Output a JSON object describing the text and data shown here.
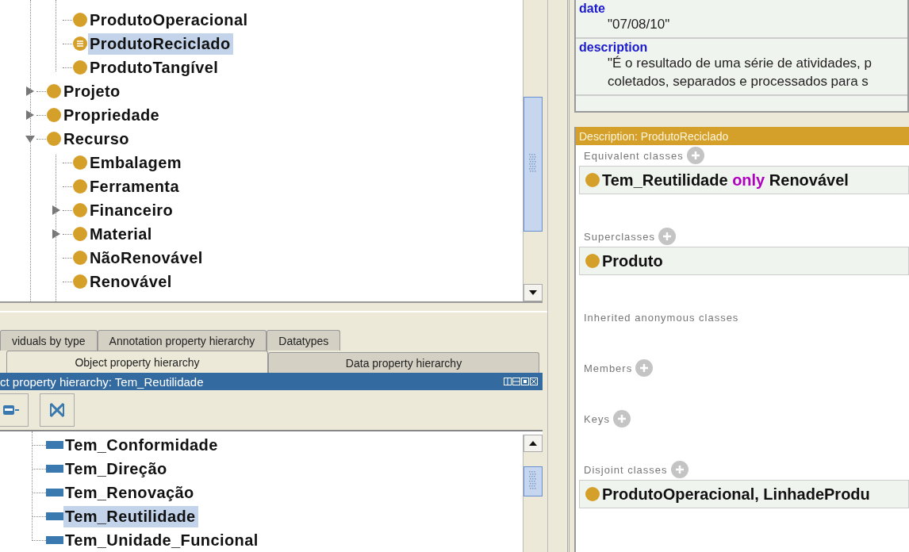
{
  "class_tree": {
    "partial_children": [
      {
        "label": "ProdutoOperacional",
        "kind": "primitive",
        "selected": false
      },
      {
        "label": "ProdutoReciclado",
        "kind": "defined",
        "selected": true
      },
      {
        "label": "ProdutoTangível",
        "kind": "primitive",
        "selected": false
      }
    ],
    "items": [
      {
        "label": "Projeto",
        "kind": "primitive",
        "selected": false,
        "expanded": false
      },
      {
        "label": "Propriedade",
        "kind": "primitive",
        "selected": false,
        "expanded": false
      },
      {
        "label": "Recurso",
        "kind": "primitive",
        "selected": false,
        "expanded": true,
        "children": [
          {
            "label": "Embalagem",
            "kind": "primitive",
            "selected": false
          },
          {
            "label": "Ferramenta",
            "kind": "primitive",
            "selected": false
          },
          {
            "label": "Financeiro",
            "kind": "primitive",
            "selected": false,
            "expanded": false
          },
          {
            "label": "Material",
            "kind": "primitive",
            "selected": false,
            "expanded": false
          },
          {
            "label": "NãoRenovável",
            "kind": "primitive",
            "selected": false
          },
          {
            "label": "Renovável",
            "kind": "primitive",
            "selected": false
          }
        ]
      }
    ]
  },
  "tab_rows": [
    [
      {
        "label": "viduals by type",
        "selected": false
      },
      {
        "label": "Annotation property hierarchy",
        "selected": false
      },
      {
        "label": "Datatypes",
        "selected": false
      }
    ],
    [
      {
        "label": "Object property hierarchy",
        "selected": true
      },
      {
        "label": "Data property hierarchy",
        "selected": false
      }
    ]
  ],
  "view": {
    "title": "ct property hierarchy: Tem_Reutilidade"
  },
  "properties": [
    {
      "label": "Tem_Conformidade",
      "selected": false
    },
    {
      "label": "Tem_Direção",
      "selected": false
    },
    {
      "label": "Tem_Renovação",
      "selected": false
    },
    {
      "label": "Tem_Reutilidade",
      "selected": true
    },
    {
      "label": "Tem_Unidade_Funcional",
      "selected": false
    }
  ],
  "annotations": [
    {
      "property": "date",
      "lines": [
        "\"07/08/10\""
      ]
    },
    {
      "property": "description",
      "lines": [
        "\"É o resultado de uma série de atividades, p",
        "coletados, separados e processados para s"
      ]
    }
  ],
  "description_panel": {
    "title": "Description: ProdutoReciclado",
    "sections": [
      {
        "title": "Equivalent classes",
        "addable": true,
        "entries": [
          {
            "parts": [
              {
                "kind": "name",
                "text": "Tem_Reutilidade"
              },
              {
                "kind": "keyword",
                "text": "only"
              },
              {
                "kind": "name",
                "text": "Renovável"
              }
            ]
          }
        ]
      },
      {
        "title": "Superclasses",
        "addable": true,
        "entries": [
          {
            "parts": [
              {
                "kind": "name",
                "text": "Produto"
              }
            ]
          }
        ]
      },
      {
        "title": "Inherited anonymous classes",
        "addable": false
      },
      {
        "title": "Members",
        "addable": true
      },
      {
        "title": "Keys",
        "addable": true
      },
      {
        "title": "Disjoint classes",
        "addable": true,
        "entries": [
          {
            "parts": [
              {
                "kind": "name",
                "text": "ProdutoOperacional, LinhadeProdu"
              }
            ]
          }
        ]
      }
    ]
  }
}
